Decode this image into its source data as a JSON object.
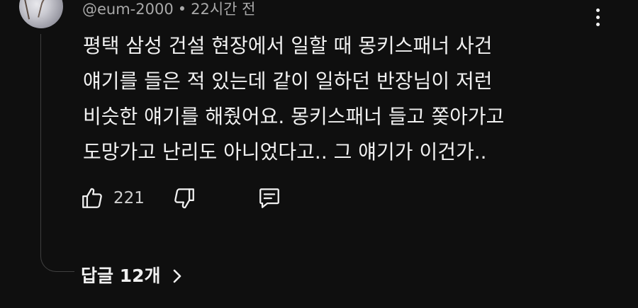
{
  "comment": {
    "author": "@eum-2000",
    "separator": "•",
    "time": "22시간 전",
    "text_lines": [
      "평택 삼성 건설 현장에서 일할 때 몽키스패너 사건",
      "얘기를 들은 적 있는데 같이 일하던 반장님이 저런",
      "비슷한 얘기를 해줬어요. 몽키스패너 들고 쫒아가고",
      "도망가고 난리도 아니었다고.. 그 얘기가 이건가.."
    ],
    "like_count": "221",
    "replies_label": "답글 12개"
  },
  "icons": {
    "more": "more-vert-icon",
    "like": "thumbs-up-icon",
    "dislike": "thumbs-down-icon",
    "reply": "comment-icon",
    "expand": "chevron-right-icon"
  },
  "colors": {
    "background": "#0f0f0f",
    "text": "#f1f1f1",
    "meta": "#a9a9a9",
    "thread_line": "#3f3f3f"
  }
}
